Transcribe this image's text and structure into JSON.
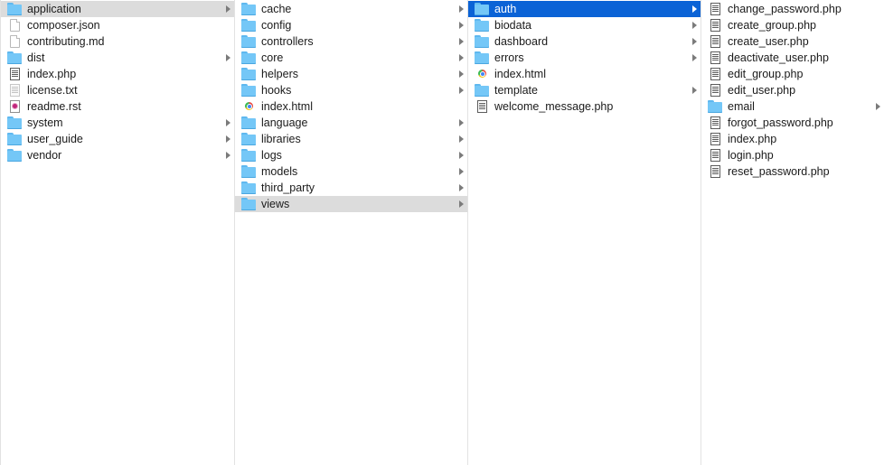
{
  "columns": [
    {
      "name": "root",
      "items": [
        {
          "label": "application",
          "kind": "folder",
          "state": "trail"
        },
        {
          "label": "composer.json",
          "kind": "doc",
          "state": ""
        },
        {
          "label": "contributing.md",
          "kind": "doc",
          "state": ""
        },
        {
          "label": "dist",
          "kind": "folder",
          "state": ""
        },
        {
          "label": "index.php",
          "kind": "php",
          "state": ""
        },
        {
          "label": "license.txt",
          "kind": "txt",
          "state": ""
        },
        {
          "label": "readme.rst",
          "kind": "rst",
          "state": ""
        },
        {
          "label": "system",
          "kind": "folder",
          "state": ""
        },
        {
          "label": "user_guide",
          "kind": "folder",
          "state": ""
        },
        {
          "label": "vendor",
          "kind": "folder",
          "state": ""
        }
      ]
    },
    {
      "name": "application",
      "items": [
        {
          "label": "cache",
          "kind": "folder",
          "state": ""
        },
        {
          "label": "config",
          "kind": "folder",
          "state": ""
        },
        {
          "label": "controllers",
          "kind": "folder",
          "state": ""
        },
        {
          "label": "core",
          "kind": "folder",
          "state": ""
        },
        {
          "label": "helpers",
          "kind": "folder",
          "state": ""
        },
        {
          "label": "hooks",
          "kind": "folder",
          "state": ""
        },
        {
          "label": "index.html",
          "kind": "html",
          "state": ""
        },
        {
          "label": "language",
          "kind": "folder",
          "state": ""
        },
        {
          "label": "libraries",
          "kind": "folder",
          "state": ""
        },
        {
          "label": "logs",
          "kind": "folder",
          "state": ""
        },
        {
          "label": "models",
          "kind": "folder",
          "state": ""
        },
        {
          "label": "third_party",
          "kind": "folder",
          "state": ""
        },
        {
          "label": "views",
          "kind": "folder",
          "state": "trail"
        }
      ]
    },
    {
      "name": "views",
      "items": [
        {
          "label": "auth",
          "kind": "folder",
          "state": "active"
        },
        {
          "label": "biodata",
          "kind": "folder",
          "state": ""
        },
        {
          "label": "dashboard",
          "kind": "folder",
          "state": ""
        },
        {
          "label": "errors",
          "kind": "folder",
          "state": ""
        },
        {
          "label": "index.html",
          "kind": "html",
          "state": ""
        },
        {
          "label": "template",
          "kind": "folder",
          "state": ""
        },
        {
          "label": "welcome_message.php",
          "kind": "php",
          "state": ""
        }
      ]
    },
    {
      "name": "auth",
      "items": [
        {
          "label": "change_password.php",
          "kind": "php",
          "state": ""
        },
        {
          "label": "create_group.php",
          "kind": "php",
          "state": ""
        },
        {
          "label": "create_user.php",
          "kind": "php",
          "state": ""
        },
        {
          "label": "deactivate_user.php",
          "kind": "php",
          "state": ""
        },
        {
          "label": "edit_group.php",
          "kind": "php",
          "state": ""
        },
        {
          "label": "edit_user.php",
          "kind": "php",
          "state": ""
        },
        {
          "label": "email",
          "kind": "folder",
          "state": ""
        },
        {
          "label": "forgot_password.php",
          "kind": "php",
          "state": ""
        },
        {
          "label": "index.php",
          "kind": "php",
          "state": ""
        },
        {
          "label": "login.php",
          "kind": "php",
          "state": ""
        },
        {
          "label": "reset_password.php",
          "kind": "php",
          "state": ""
        }
      ]
    }
  ],
  "icons": {
    "folder": "folder-icon",
    "doc": "document-icon",
    "php": "php-file-icon",
    "txt": "text-file-icon",
    "rst": "rst-file-icon",
    "html": "html-file-icon"
  },
  "colors": {
    "selection": "#0b63d6",
    "trail": "#dcdcdc",
    "folder": "#74c7f7"
  }
}
